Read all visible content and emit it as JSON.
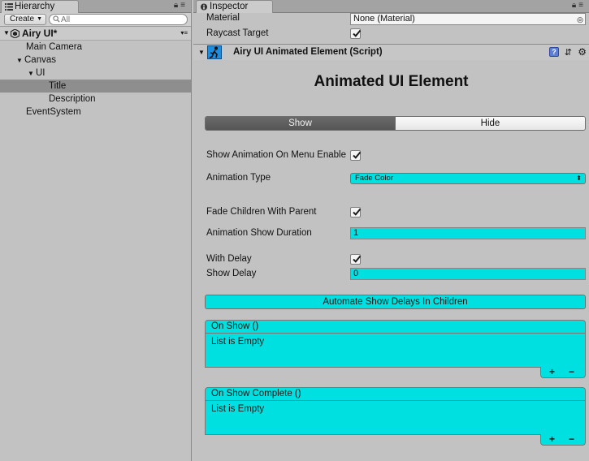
{
  "hierarchy": {
    "tab_label": "Hierarchy",
    "create_label": "Create",
    "search_placeholder": "All",
    "scene_name": "Airy UI*",
    "items": [
      {
        "label": "Main Camera",
        "fold": ""
      },
      {
        "label": "Canvas",
        "fold": "▼"
      },
      {
        "label": "UI",
        "fold": "▼"
      },
      {
        "label": "Title",
        "fold": ""
      },
      {
        "label": "Description",
        "fold": ""
      },
      {
        "label": "EventSystem",
        "fold": ""
      }
    ],
    "selected_item": "Title"
  },
  "inspector": {
    "tab_label": "Inspector",
    "material_label": "Material",
    "material_value": "None (Material)",
    "raycast_label": "Raycast Target",
    "raycast_checked": true,
    "component_title": "Airy UI Animated Element (Script)",
    "help_glyph": "?",
    "heading": "Animated UI Element",
    "toggle": {
      "show": "Show",
      "hide": "Hide",
      "active": "Show"
    },
    "show_on_enable_label": "Show Animation On Menu Enable",
    "show_on_enable_checked": true,
    "animation_type_label": "Animation Type",
    "animation_type_value": "Fade Color",
    "fade_children_label": "Fade Children With Parent",
    "fade_children_checked": true,
    "duration_label": "Animation Show Duration",
    "duration_value": "1",
    "with_delay_label": "With Delay",
    "with_delay_checked": true,
    "show_delay_label": "Show Delay",
    "show_delay_value": "0",
    "automate_button": "Automate Show Delays In Children",
    "events": [
      {
        "title": "On Show ()",
        "body": "List is Empty"
      },
      {
        "title": "On Show Complete ()",
        "body": "List is Empty"
      }
    ],
    "add_glyph": "+",
    "remove_glyph": "−"
  },
  "colors": {
    "panel_bg": "#c2c2c2",
    "accent_cyan": "#00e0e0",
    "selection": "#8e8e8e"
  },
  "icons": [
    "hierarchy-icon",
    "lock-icon",
    "menu-icon",
    "search-icon",
    "unity-logo-icon",
    "inspector-icon",
    "script-icon",
    "help-icon",
    "preset-icon",
    "gear-icon",
    "checkmark-icon",
    "dropdown-arrow-icon",
    "object-picker-icon"
  ]
}
